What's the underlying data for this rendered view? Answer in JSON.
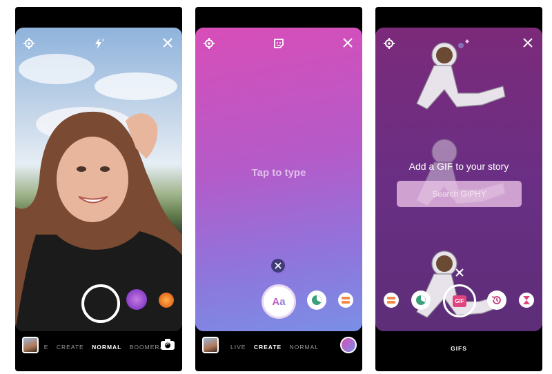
{
  "screen1": {
    "icons": {
      "settings": "gear-icon",
      "flash": "flash-off-icon",
      "close": "close-icon",
      "flip": "camera-flip-icon"
    },
    "modes": [
      "E",
      "CREATE",
      "NORMAL",
      "BOOMERA"
    ],
    "active_mode": "NORMAL"
  },
  "screen2": {
    "icons": {
      "settings": "gear-icon",
      "sticker": "sticker-icon",
      "close": "close-icon"
    },
    "prompt": "Tap to type",
    "text_button_label": "Aa",
    "modes": [
      "LIVE",
      "CREATE",
      "NORMAL"
    ],
    "active_mode": "CREATE"
  },
  "screen3": {
    "icons": {
      "settings": "gear-icon",
      "close": "close-icon"
    },
    "title": "Add a GIF to your story",
    "search_placeholder": "Search GIPHY",
    "gif_button_label": "GIF",
    "mode_label": "GIFS"
  },
  "colors": {
    "text_pink": "#d84db8",
    "text_blue": "#7a8fe6",
    "gif_purple": "#6a2f84",
    "accent_pink": "#e0457f"
  }
}
